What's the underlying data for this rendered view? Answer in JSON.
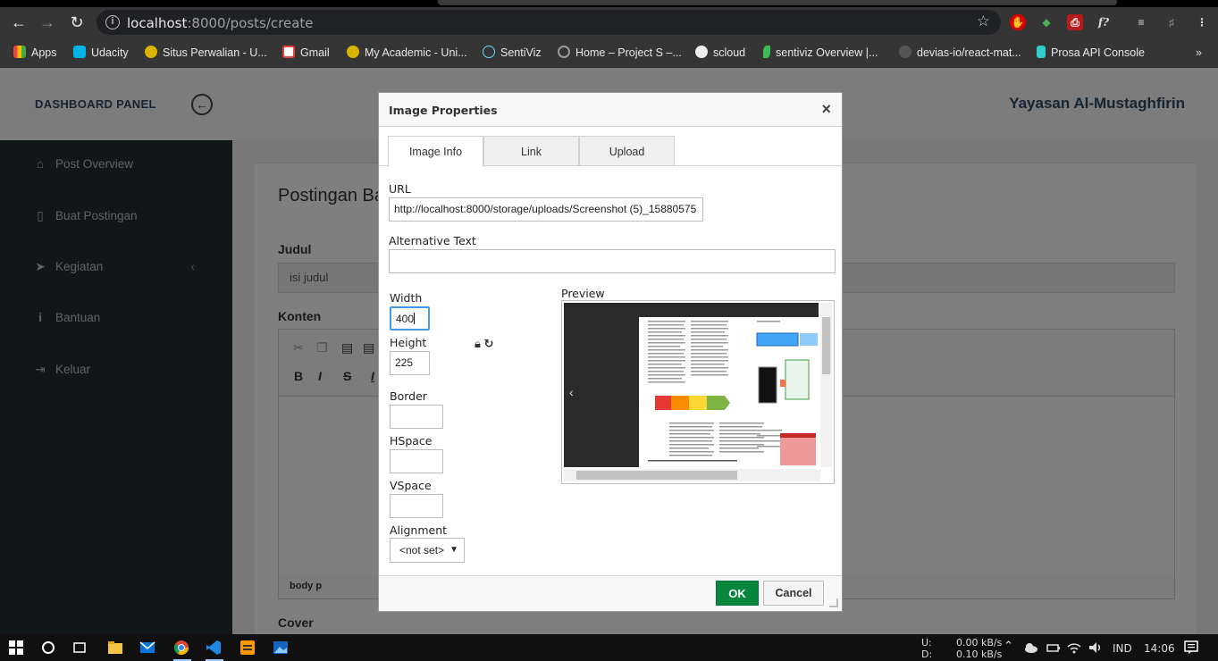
{
  "browser": {
    "url_host": "localhost",
    "url_rest": ":8000/posts/create",
    "bookmarks": [
      {
        "label": "Apps",
        "icon": "apps-grid-icon",
        "color": "#e44"
      },
      {
        "label": "Udacity",
        "icon": "udacity-icon",
        "color": "#02b3e4"
      },
      {
        "label": "Situs Perwalian - U...",
        "icon": "university-seal-icon",
        "color": "#d9b400"
      },
      {
        "label": "Gmail",
        "icon": "gmail-icon",
        "color": "#ea4335"
      },
      {
        "label": "My Academic - Uni...",
        "icon": "university-seal-icon",
        "color": "#d9b400"
      },
      {
        "label": "SentiViz",
        "icon": "react-icon",
        "color": "#61dafb"
      },
      {
        "label": "Home – Project S –...",
        "icon": "gear-icon",
        "color": "#999"
      },
      {
        "label": "scloud",
        "icon": "cloud-icon",
        "color": "#eee"
      },
      {
        "label": "sentiviz Overview |...",
        "icon": "leaf-icon",
        "color": "#3dbb54"
      },
      {
        "label": "devias-io/react-mat...",
        "icon": "github-icon",
        "color": "#ccc"
      },
      {
        "label": "Prosa API Console",
        "icon": "prosa-icon",
        "color": "#3cc"
      }
    ]
  },
  "app": {
    "brand": "DASHBOARD PANEL",
    "org": "Yayasan Al-Mustaghfirin",
    "sidebar": [
      {
        "label": "Post Overview",
        "icon": "home-icon",
        "glyph": "⌂"
      },
      {
        "label": "Buat Postingan",
        "icon": "file-icon",
        "glyph": "▯"
      },
      {
        "label": "Kegiatan",
        "icon": "paper-plane-icon",
        "glyph": "➤"
      },
      {
        "label": "Bantuan",
        "icon": "info-icon",
        "glyph": "i"
      },
      {
        "label": "Keluar",
        "icon": "sign-out-icon",
        "glyph": "⇥"
      }
    ],
    "page_title": "Postingan Ba",
    "judul_label": "Judul",
    "judul_value": "isi judul",
    "konten_label": "Konten",
    "editor_path": "body  p",
    "cover_label": "Cover"
  },
  "dialog": {
    "title": "Image Properties",
    "tabs": [
      "Image Info",
      "Link",
      "Upload"
    ],
    "url_label": "URL",
    "url_value": "http://localhost:8000/storage/uploads/Screenshot (5)_15880575",
    "alt_label": "Alternative Text",
    "alt_value": "",
    "width_label": "Width",
    "width_value": "400",
    "height_label": "Height",
    "height_value": "225",
    "border_label": "Border",
    "hspace_label": "HSpace",
    "vspace_label": "VSpace",
    "alignment_label": "Alignment",
    "alignment_value": "<not set>",
    "preview_label": "Preview",
    "ok_label": "OK",
    "cancel_label": "Cancel"
  },
  "taskbar": {
    "up_label": "U:",
    "down_label": "D:",
    "up_rate": "0.00 kB/s",
    "down_rate": "0.10 kB/s",
    "lang": "IND",
    "time": "14:06"
  }
}
